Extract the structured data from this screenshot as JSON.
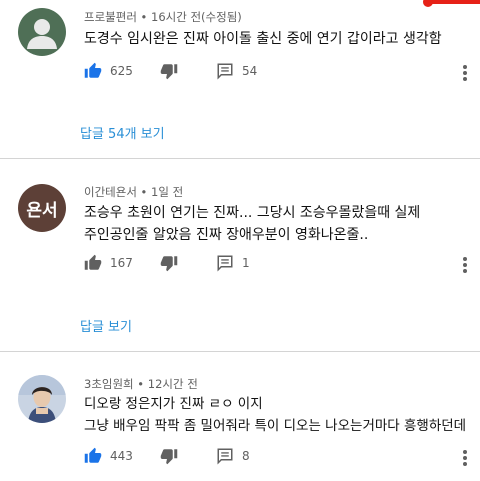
{
  "comments": [
    {
      "author": "프로불편러",
      "time": "16시간 전(수정됨)",
      "text": "도경수 임시완은 진짜 아이돌 출신 중에 연기 갑이라고 생각함",
      "likes": "625",
      "replies_count": "54",
      "reply_link": "답글 54개 보기",
      "avatar": "default-avatar-icon",
      "liked": true
    },
    {
      "author": "이간테욘서",
      "time": "1일 전",
      "text": "조승우 초원이 연기는 진짜... 그당시 조승우몰랐을때 실제\n주인공인줄 알았음 진짜 장애우분이 영화나온줄..",
      "likes": "167",
      "replies_count": "1",
      "reply_link": "답글 보기",
      "avatar_text": "욘서",
      "avatar_color": "#5d4037",
      "liked": false
    },
    {
      "author": "3초임원희",
      "time": "12시간 전",
      "text": "디오랑 정은지가 진짜 ㄹㅇ 이지\n그냥 배우임 팍팍 좀 밀어줘라 특이 디오는 나오는거마다 흥행하던데",
      "likes": "443",
      "replies_count": "8",
      "avatar": "photo-avatar",
      "liked": true
    }
  ],
  "colors": {
    "accent_blue": "#1a73e8",
    "link_blue": "#2a8fd6",
    "icon_gray": "#606060",
    "progress_red": "#e62117"
  },
  "meta_separator": " • "
}
